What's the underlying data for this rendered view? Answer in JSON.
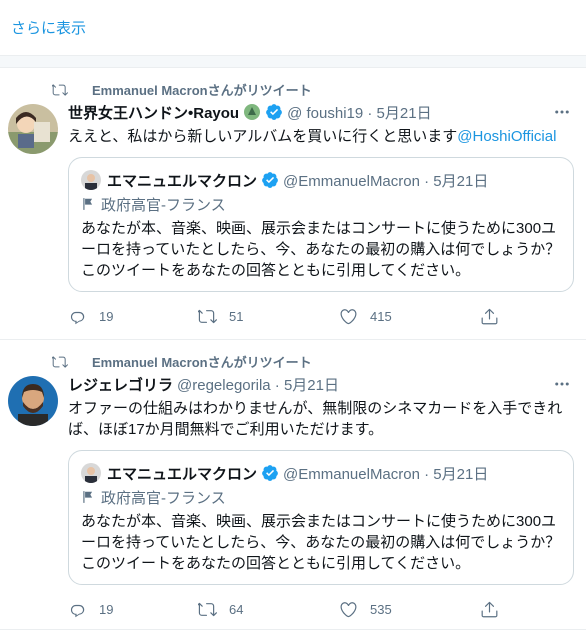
{
  "show_more": "さらに表示",
  "tweets": [
    {
      "retweeted_by": "Emmanuel Macronさんがリツイート",
      "name": "世界女王ハンドン•Rayou",
      "handle_date": "@ foushi19 · 5月21日",
      "text": "ええと、私はから新しいアルバムを買いに行くと思います",
      "mention": "@HoshiOfficial",
      "quote": {
        "name": "エマニュエルマクロン",
        "handle_date": "@EmmanuelMacron · 5月21日",
        "label": "政府高官-フランス",
        "text": "あなたが本、音楽、映画、展示会またはコンサートに使うために300ユーロを持っていたとしたら、今、あなたの最初の購入は何でしょうか？このツイートをあなたの回答とともに引用してください。"
      },
      "counts": {
        "reply": "19",
        "retweet": "51",
        "like": "415"
      }
    },
    {
      "retweeted_by": "Emmanuel Macronさんがリツイート",
      "name": "レジェレゴリラ",
      "handle_date": "@regelegorila · 5月21日",
      "text": "オファーの仕組みはわかりませんが、無制限のシネマカードを入手できれば、ほぼ17か月間無料でご利用いただけます。",
      "quote": {
        "name": "エマニュエルマクロン",
        "handle_date": "@EmmanuelMacron · 5月21日",
        "label": "政府高官-フランス",
        "text": "あなたが本、音楽、映画、展示会またはコンサートに使うために300ユーロを持っていたとしたら、今、あなたの最初の購入は何でしょうか？このツイートをあなたの回答とともに引用してください。"
      },
      "counts": {
        "reply": "19",
        "retweet": "64",
        "like": "535"
      }
    }
  ],
  "colors": {
    "link": "#1b95e0",
    "muted": "#5b7083",
    "verified": "#1da1f2",
    "border": "#ebeef0"
  },
  "icons": [
    "retweet-icon",
    "verified-badge-icon",
    "more-icon",
    "flag-icon",
    "reply-icon",
    "like-icon",
    "share-icon"
  ]
}
